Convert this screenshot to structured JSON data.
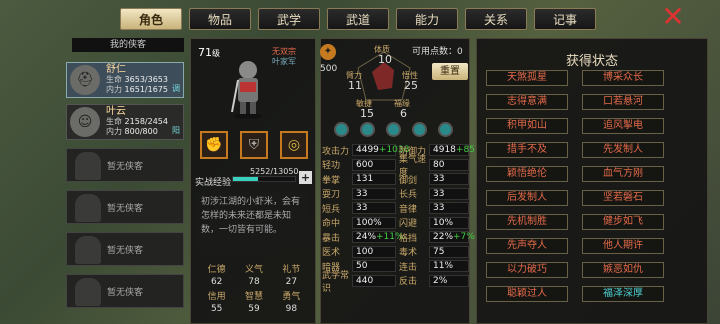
{
  "tabs": [
    "角色",
    "物品",
    "武学",
    "武道",
    "能力",
    "关系",
    "记事"
  ],
  "left": {
    "header": "我的侠客",
    "chars": [
      {
        "name": "舒仁",
        "hp_label": "生命",
        "hp": "3653/3653",
        "mp_label": "内力",
        "mp": "1651/1675",
        "tag": "调"
      },
      {
        "name": "叶云",
        "hp_label": "生命",
        "hp": "2158/2454",
        "mp_label": "内力",
        "mp": "800/800",
        "tag": "阳"
      }
    ],
    "empty": "暂无侠客"
  },
  "hero": {
    "level": "71",
    "level_unit": "级",
    "school": "无双宗",
    "rank": "叶家军",
    "points": "500",
    "free_label": "可用点数：",
    "free_value": "0",
    "reset": "重置",
    "attrs": [
      {
        "l": "体质",
        "v": "10"
      },
      {
        "l": "臂力",
        "v": "11"
      },
      {
        "l": "悟性",
        "v": "25"
      },
      {
        "l": "敏捷",
        "v": "15"
      },
      {
        "l": "福缘",
        "v": "6"
      }
    ],
    "exp_label": "实战经验",
    "exp": "5252/13050",
    "exp_frac": 0.4,
    "desc": "初涉江湖的小虾米，会有怎样的未来还都是未知数，一切皆有可能。",
    "virtues": [
      {
        "l": "仁德",
        "v": "62"
      },
      {
        "l": "义气",
        "v": "78"
      },
      {
        "l": "礼节",
        "v": "27"
      },
      {
        "l": "信用",
        "v": "55"
      },
      {
        "l": "智慧",
        "v": "59"
      },
      {
        "l": "勇气",
        "v": "98"
      }
    ]
  },
  "stats": [
    [
      "攻击力",
      "4499",
      "+1038",
      "防御力",
      "4918",
      "+857"
    ],
    [
      "轻功",
      "600",
      "",
      "集气速度",
      "80",
      ""
    ],
    [
      "拳掌",
      "131",
      "",
      "御剑",
      "33",
      ""
    ],
    [
      "耍刀",
      "33",
      "",
      "长兵",
      "33",
      ""
    ],
    [
      "短兵",
      "33",
      "",
      "音律",
      "33",
      ""
    ],
    [
      "命中",
      "100%",
      "",
      "闪避",
      "10%",
      ""
    ],
    [
      "暴击",
      "24%",
      "+11%",
      "格挡",
      "22%",
      "+7%"
    ],
    [
      "医术",
      "100",
      "",
      "毒术",
      "75",
      ""
    ],
    [
      "暗器",
      "50",
      "",
      "连击",
      "11%",
      ""
    ],
    [
      "武学常识",
      "440",
      "",
      "反击",
      "2%",
      ""
    ]
  ],
  "right": {
    "title": "获得状态",
    "states": [
      [
        "天煞孤星",
        "博采众长"
      ],
      [
        "志得意满",
        "口若悬河"
      ],
      [
        "积甲如山",
        "追风掣电"
      ],
      [
        "措手不及",
        "先发制人"
      ],
      [
        "颖悟绝伦",
        "血气方刚"
      ],
      [
        "后发制人",
        "坚若磐石"
      ],
      [
        "先机制胜",
        "健步如飞"
      ],
      [
        "先声夺人",
        "他人期许"
      ],
      [
        "以力破巧",
        "嫉恶如仇"
      ],
      [
        "聪颖过人",
        "福泽深厚"
      ]
    ],
    "colors": [
      [
        "#e36a4a",
        "#e36a4a"
      ],
      [
        "#e36a4a",
        "#e36a4a"
      ],
      [
        "#e36a4a",
        "#e36a4a"
      ],
      [
        "#e36a4a",
        "#e36a4a"
      ],
      [
        "#e36a4a",
        "#e36a4a"
      ],
      [
        "#e36a4a",
        "#e36a4a"
      ],
      [
        "#e36a4a",
        "#e36a4a"
      ],
      [
        "#e36a4a",
        "#e36a4a"
      ],
      [
        "#e36a4a",
        "#e36a4a"
      ],
      [
        "#e36a4a",
        "#4ed0d0"
      ]
    ]
  }
}
